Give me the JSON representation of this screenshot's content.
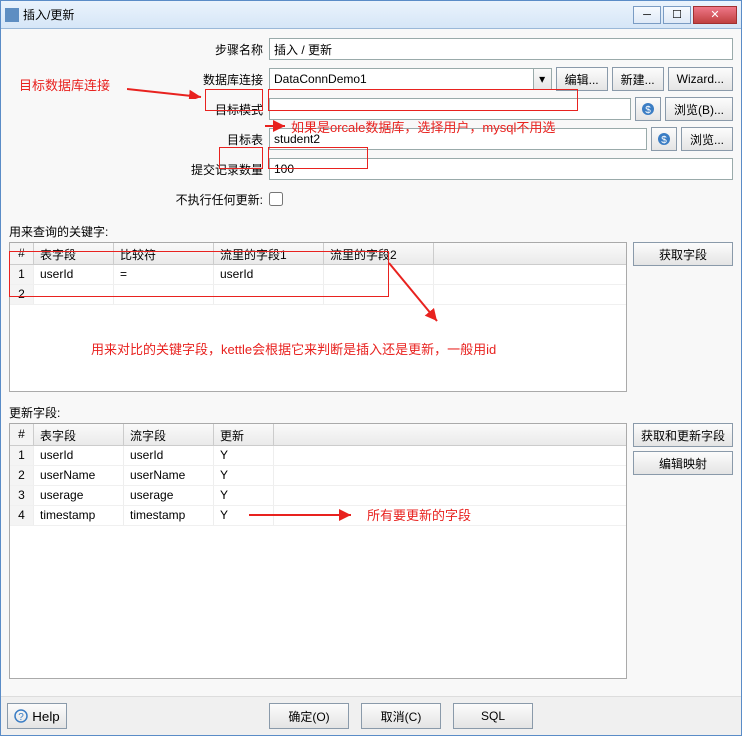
{
  "window": {
    "title": "插入/更新"
  },
  "form": {
    "step_name_label": "步骤名称",
    "step_name_value": "插入 / 更新",
    "db_conn_label": "数据库连接",
    "db_conn_value": "DataConnDemo1",
    "edit_btn": "编辑...",
    "new_btn": "新建...",
    "wizard_btn": "Wizard...",
    "target_schema_label": "目标模式",
    "target_schema_value": "",
    "browse_b_btn": "浏览(B)...",
    "target_table_label": "目标表",
    "target_table_value": "student2",
    "browse_btn": "浏览...",
    "commit_size_label": "提交记录数量",
    "commit_size_value": "100",
    "no_update_label": "不执行任何更新:"
  },
  "key_section": {
    "label": "用来查询的关键字:",
    "headers": {
      "num": "#",
      "table_field": "表字段",
      "comparator": "比较符",
      "stream_field1": "流里的字段1",
      "stream_field2": "流里的字段2"
    },
    "rows": [
      {
        "num": "1",
        "table_field": "userId",
        "comparator": "=",
        "stream_field1": "userId",
        "stream_field2": ""
      },
      {
        "num": "2",
        "table_field": "",
        "comparator": "",
        "stream_field1": "",
        "stream_field2": ""
      }
    ],
    "get_fields_btn": "获取字段"
  },
  "update_section": {
    "label": "更新字段:",
    "headers": {
      "num": "#",
      "table_field": "表字段",
      "stream_field": "流字段",
      "update": "更新"
    },
    "rows": [
      {
        "num": "1",
        "table_field": "userId",
        "stream_field": "userId",
        "update": "Y"
      },
      {
        "num": "2",
        "table_field": "userName",
        "stream_field": "userName",
        "update": "Y"
      },
      {
        "num": "3",
        "table_field": "userage",
        "stream_field": "userage",
        "update": "Y"
      },
      {
        "num": "4",
        "table_field": "timestamp",
        "stream_field": "timestamp",
        "update": "Y"
      }
    ],
    "get_update_fields_btn": "获取和更新字段",
    "edit_mapping_btn": "编辑映射"
  },
  "bottom": {
    "help": "Help",
    "ok": "确定(O)",
    "cancel": "取消(C)",
    "sql": "SQL"
  },
  "annotations": {
    "db_conn": "目标数据库连接",
    "target_schema_note": "如果是orcale数据库，选择用户，mysql不用选",
    "key_note": "用来对比的关键字段，kettle会根据它来判断是插入还是更新，一般用id",
    "update_note": "所有要更新的字段"
  }
}
